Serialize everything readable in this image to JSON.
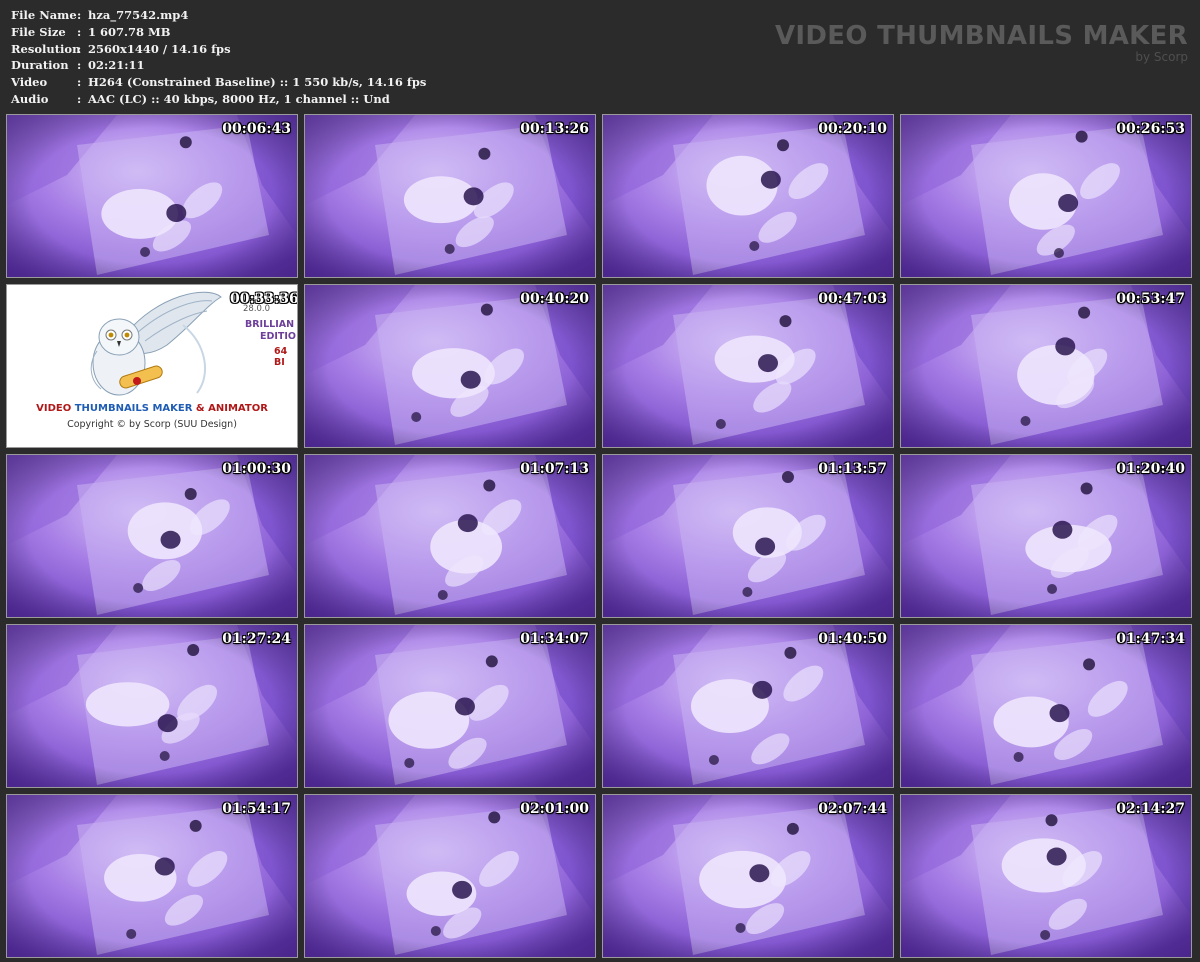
{
  "header": {
    "rows": [
      {
        "label": "File Name",
        "sep": ":",
        "value": "hza_77542.mp4"
      },
      {
        "label": "File Size",
        "sep": ":",
        "value": "1 607.78 MB"
      },
      {
        "label": "Resolution",
        "sep": ":",
        "value": "2560x1440 / 14.16 fps"
      },
      {
        "label": "Duration",
        "sep": ":",
        "value": "02:21:11"
      },
      {
        "label": "Video",
        "sep": ":",
        "value": "H264 (Constrained Baseline) :: 1 550 kb/s, 14.16 fps"
      },
      {
        "label": "Audio",
        "sep": ":",
        "value": "AAC (LC) :: 40 kbps, 8000 Hz, 1 channel :: Und"
      }
    ]
  },
  "brand": {
    "title": "VIDEO THUMBNAILS MAKER",
    "subtitle": "by Scorp"
  },
  "logo_thumb": {
    "timestamp": "00:33:36",
    "version_fragment": "28.0.0",
    "edition_line1": "BRILLIAN",
    "edition_line2": "EDITIO",
    "edition_line3": "64 BI",
    "app_name_part1": "VIDEO",
    "app_name_part2": "THUMBNAILS MAKER",
    "app_name_part3": "& ANIMATOR",
    "copyright": "Copyright © by Scorp (SUU Design)"
  },
  "thumbnails": [
    {
      "timestamp": "00:06:43"
    },
    {
      "timestamp": "00:13:26"
    },
    {
      "timestamp": "00:20:10"
    },
    {
      "timestamp": "00:26:53"
    },
    {
      "timestamp": "logo"
    },
    {
      "timestamp": "00:40:20"
    },
    {
      "timestamp": "00:47:03"
    },
    {
      "timestamp": "00:53:47"
    },
    {
      "timestamp": "01:00:30"
    },
    {
      "timestamp": "01:07:13"
    },
    {
      "timestamp": "01:13:57"
    },
    {
      "timestamp": "01:20:40"
    },
    {
      "timestamp": "01:27:24"
    },
    {
      "timestamp": "01:34:07"
    },
    {
      "timestamp": "01:40:50"
    },
    {
      "timestamp": "01:47:34"
    },
    {
      "timestamp": "01:54:17"
    },
    {
      "timestamp": "02:01:00"
    },
    {
      "timestamp": "02:07:44"
    },
    {
      "timestamp": "02:14:27"
    }
  ],
  "colors": {
    "background": "#2b2b2b",
    "scene_base": "#7e52cf",
    "scene_light": "#c6a8f2",
    "scene_dark": "#3a1e6b"
  }
}
